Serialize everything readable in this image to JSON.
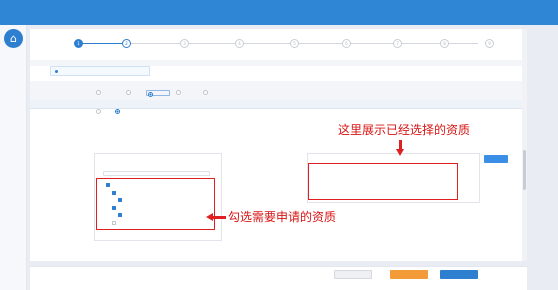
{
  "header": {
    "title": ""
  },
  "sidebar": {
    "home_icon": "house-icon",
    "home_label": ""
  },
  "page": {
    "breadcrumb": ""
  },
  "stepper": {
    "steps": [
      {
        "num": "1",
        "label": "",
        "state": "done"
      },
      {
        "num": "2",
        "label": "",
        "state": "current"
      },
      {
        "num": "3",
        "label": "",
        "state": "todo"
      },
      {
        "num": "4",
        "label": "",
        "state": "todo"
      },
      {
        "num": "5",
        "label": "",
        "state": "todo"
      },
      {
        "num": "6",
        "label": "",
        "state": "todo"
      },
      {
        "num": "7",
        "label": "",
        "state": "todo"
      },
      {
        "num": "8",
        "label": "",
        "state": "todo"
      },
      {
        "num": "9",
        "label": "",
        "state": "todo"
      }
    ]
  },
  "section": {
    "title": "",
    "apply_type_label": "",
    "apply_type_options": [
      {
        "label": "",
        "selected": false
      },
      {
        "label": "",
        "selected": false
      },
      {
        "label": "",
        "selected": true
      },
      {
        "label": "",
        "selected": false
      },
      {
        "label": "",
        "selected": false
      }
    ],
    "dept_label": "",
    "dept_options": [
      {
        "label": "",
        "selected": false
      },
      {
        "label": "",
        "selected": true
      }
    ],
    "qual_label": ""
  },
  "left_panel": {
    "title": "",
    "search_placeholder": "",
    "tree": [
      {
        "label": "",
        "checked": true
      },
      {
        "label": "",
        "checked": true
      },
      {
        "label": "",
        "checked": true
      },
      {
        "label": "",
        "checked": true
      },
      {
        "label": "",
        "checked": true
      },
      {
        "label": "",
        "checked": false
      }
    ]
  },
  "right_panel": {
    "title": "",
    "clear_button": "",
    "selected": [
      {
        "label": "",
        "action": ""
      },
      {
        "label": "",
        "action": ""
      }
    ]
  },
  "annotations": {
    "right": "这里展示已经选择的资质",
    "left": "勾选需要申请的资质"
  },
  "footer": {
    "cancel": "",
    "prev": "",
    "next": ""
  },
  "colors": {
    "primary": "#2e7fd0",
    "annotation": "#e02020",
    "orange": "#f29b38"
  }
}
